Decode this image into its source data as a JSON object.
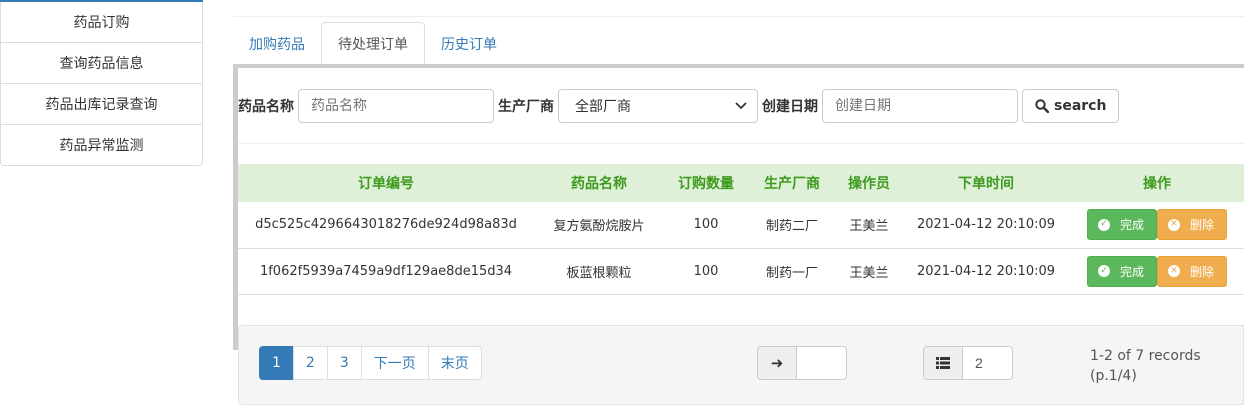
{
  "sidebar": {
    "items": [
      {
        "label": "药品订购"
      },
      {
        "label": "查询药品信息"
      },
      {
        "label": "药品出库记录查询"
      },
      {
        "label": "药品异常监测"
      }
    ]
  },
  "tabs": [
    {
      "label": "加购药品"
    },
    {
      "label": "待处理订单"
    },
    {
      "label": "历史订单"
    }
  ],
  "search": {
    "name_label": "药品名称",
    "name_placeholder": "药品名称",
    "maker_label": "生产厂商",
    "maker_selected": "全部厂商",
    "date_label": "创建日期",
    "date_placeholder": "创建日期",
    "button_label": "search"
  },
  "table": {
    "headers": [
      "订单编号",
      "药品名称",
      "订购数量",
      "生产厂商",
      "操作员",
      "下单时间",
      "操作"
    ],
    "rows": [
      {
        "id": "d5c525c4296643018276de924d98a83d",
        "drug": "复方氨酚烷胺片",
        "qty": "100",
        "maker": "制药二厂",
        "operator": "王美兰",
        "time": "2021-04-12 20:10:09"
      },
      {
        "id": "1f062f5939a7459a9df129ae8de15d34",
        "drug": "板蓝根颗粒",
        "qty": "100",
        "maker": "制药一厂",
        "operator": "王美兰",
        "time": "2021-04-12 20:10:09"
      }
    ],
    "complete_label": "完成",
    "delete_label": "删除"
  },
  "pagination": {
    "pages": [
      "1",
      "2",
      "3",
      "下一页",
      "末页"
    ],
    "goto_value": "",
    "page_size": "2",
    "records_line1": "1-2 of 7 records",
    "records_line2": "(p.1/4)"
  },
  "colors": {
    "primary": "#337ab7",
    "success": "#5cb85c",
    "warning": "#f0ad4e",
    "header_bg": "#dff0d8",
    "header_text": "#3c9a1c"
  }
}
